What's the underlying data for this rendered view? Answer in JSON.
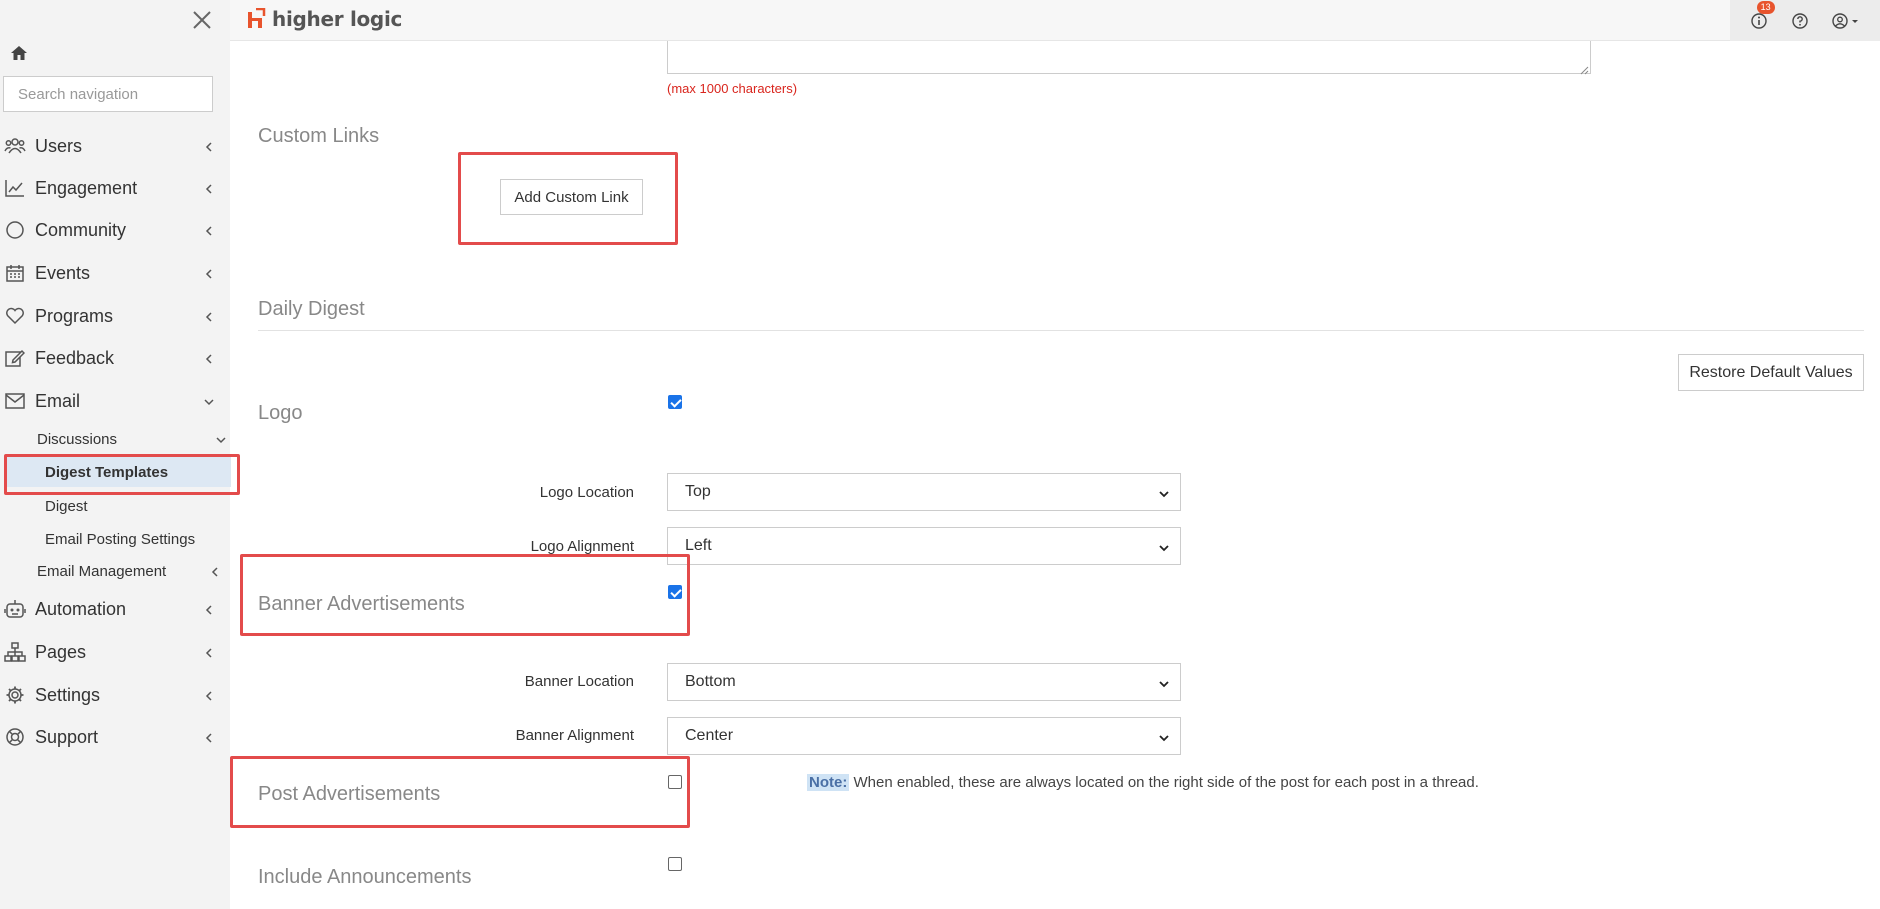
{
  "header": {
    "brand": "higher logic",
    "notification_count": "13",
    "icons": [
      "info-icon",
      "help-icon",
      "user-icon"
    ]
  },
  "sidebar": {
    "search_placeholder": "Search navigation",
    "items": [
      {
        "label": "Users",
        "icon": "users-icon"
      },
      {
        "label": "Engagement",
        "icon": "chart-icon"
      },
      {
        "label": "Community",
        "icon": "circle-icon"
      },
      {
        "label": "Events",
        "icon": "calendar-icon"
      },
      {
        "label": "Programs",
        "icon": "heart-icon"
      },
      {
        "label": "Feedback",
        "icon": "edit-icon"
      },
      {
        "label": "Email",
        "icon": "envelope-icon"
      },
      {
        "label": "Automation",
        "icon": "robot-icon"
      },
      {
        "label": "Pages",
        "icon": "sitemap-icon"
      },
      {
        "label": "Settings",
        "icon": "gear-icon"
      },
      {
        "label": "Support",
        "icon": "lifebuoy-icon"
      }
    ],
    "email_sub": {
      "discussions": "Discussions",
      "digest_templates": "Digest Templates",
      "digest": "Digest",
      "email_posting_settings": "Email Posting Settings",
      "email_management": "Email Management"
    }
  },
  "main": {
    "max_chars": "(max 1000 characters)",
    "custom_links": {
      "heading": "Custom Links",
      "add_button": "Add Custom Link"
    },
    "daily_digest": {
      "heading": "Daily Digest",
      "restore_button": "Restore Default Values"
    },
    "logo": {
      "heading": "Logo",
      "checked": true,
      "location_label": "Logo Location",
      "location_value": "Top",
      "alignment_label": "Logo Alignment",
      "alignment_value": "Left"
    },
    "banner": {
      "heading": "Banner Advertisements",
      "checked": true,
      "location_label": "Banner Location",
      "location_value": "Bottom",
      "alignment_label": "Banner Alignment",
      "alignment_value": "Center"
    },
    "post_ads": {
      "heading": "Post Advertisements",
      "checked": false,
      "note_key": "Note:",
      "note_text": " When enabled, these are always located on the right side of the post for each post in a thread."
    },
    "announcements": {
      "heading": "Include Announcements",
      "checked": false
    }
  }
}
